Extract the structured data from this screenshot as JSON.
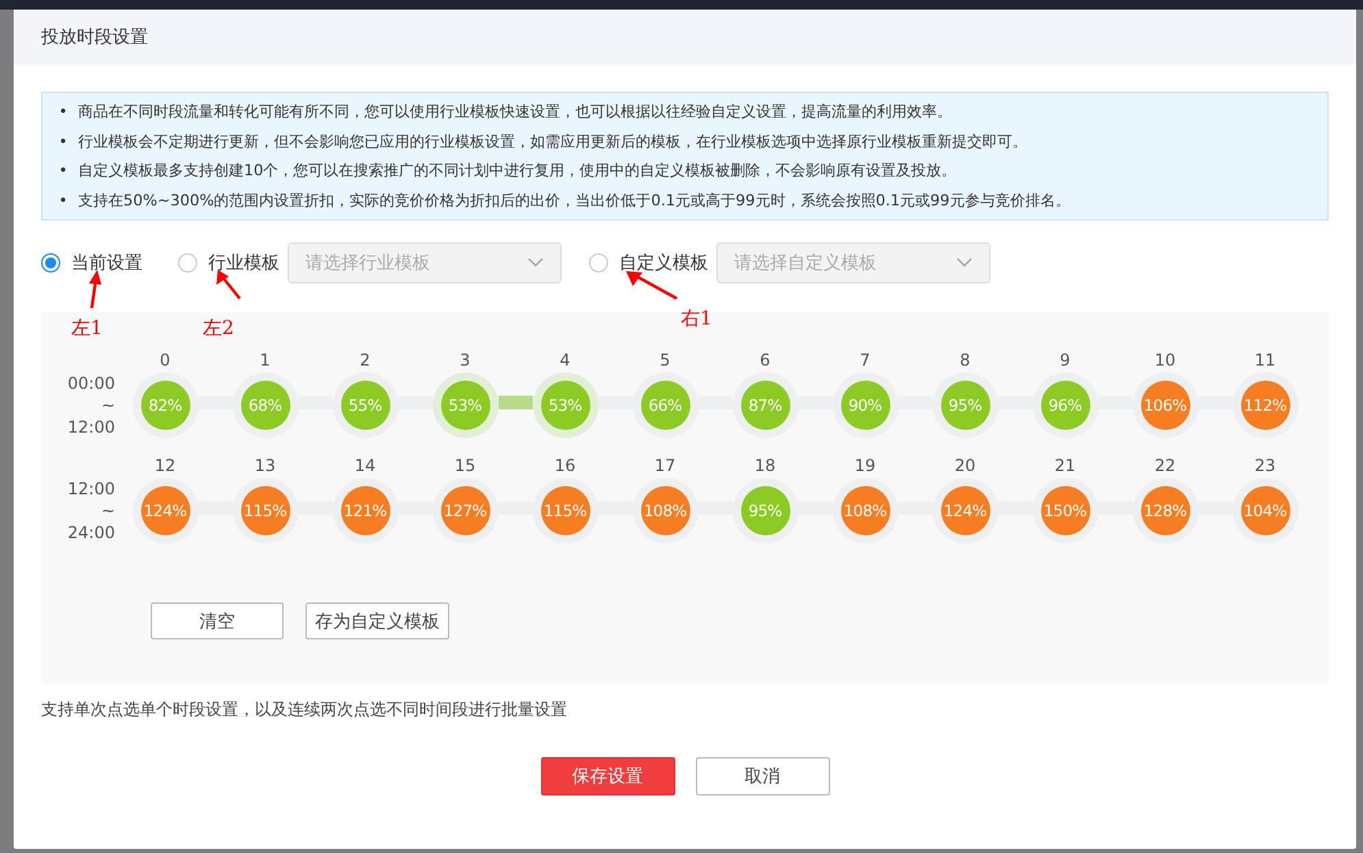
{
  "dialog": {
    "title": "投放时段设置"
  },
  "notes": [
    {
      "marker": "•",
      "text": "商品在不同时段流量和转化可能有所不同，您可以使用行业模板快速设置，也可以根据以往经验自定义设置，提高流量的利用效率。"
    },
    {
      "marker": "•",
      "text": "行业模板会不定期进行更新，但不会影响您已应用的行业模板设置，如需应用更新后的模板，在行业模板选项中选择原行业模板重新提交即可。"
    },
    {
      "marker": "•",
      "text": "自定义模板最多支持创建10个，您可以在搜索推广的不同计划中进行复用，使用中的自定义模板被删除，不会影响原有设置及投放。"
    },
    {
      "marker": "•",
      "text": "支持在50%~300%的范围内设置折扣，实际的竞价价格为折扣后的出价，当出价低于0.1元或高于99元时，系统会按照0.1元或99元参与竞价排名。"
    }
  ],
  "modes": [
    {
      "label": "当前设置",
      "selected": true
    },
    {
      "label": "行业模板",
      "selected": false,
      "placeholder": "请选择行业模板"
    },
    {
      "label": "自定义模板",
      "selected": false,
      "placeholder": "请选择自定义模板"
    }
  ],
  "rows": [
    {
      "start": "00:00",
      "sep": "~",
      "end": "12:00",
      "slots": [
        {
          "hour": "0",
          "value": "82%",
          "color": "#8ccb24",
          "selected": false
        },
        {
          "hour": "1",
          "value": "68%",
          "color": "#8ccb24",
          "selected": false
        },
        {
          "hour": "2",
          "value": "55%",
          "color": "#8ccb24",
          "selected": false
        },
        {
          "hour": "3",
          "value": "53%",
          "color": "#8ccb24",
          "selected": true
        },
        {
          "hour": "4",
          "value": "53%",
          "color": "#8ccb24",
          "selected": true
        },
        {
          "hour": "5",
          "value": "66%",
          "color": "#8ccb24",
          "selected": false
        },
        {
          "hour": "6",
          "value": "87%",
          "color": "#8ccb24",
          "selected": false
        },
        {
          "hour": "7",
          "value": "90%",
          "color": "#8ccb24",
          "selected": false
        },
        {
          "hour": "8",
          "value": "95%",
          "color": "#8ccb24",
          "selected": false
        },
        {
          "hour": "9",
          "value": "96%",
          "color": "#8ccb24",
          "selected": false
        },
        {
          "hour": "10",
          "value": "106%",
          "color": "#f57d22",
          "selected": false
        },
        {
          "hour": "11",
          "value": "112%",
          "color": "#f57d22",
          "selected": false
        }
      ]
    },
    {
      "start": "12:00",
      "sep": "~",
      "end": "24:00",
      "slots": [
        {
          "hour": "12",
          "value": "124%",
          "color": "#f57d22",
          "selected": false
        },
        {
          "hour": "13",
          "value": "115%",
          "color": "#f57d22",
          "selected": false
        },
        {
          "hour": "14",
          "value": "121%",
          "color": "#f57d22",
          "selected": false
        },
        {
          "hour": "15",
          "value": "127%",
          "color": "#f57d22",
          "selected": false
        },
        {
          "hour": "16",
          "value": "115%",
          "color": "#f57d22",
          "selected": false
        },
        {
          "hour": "17",
          "value": "108%",
          "color": "#f57d22",
          "selected": false
        },
        {
          "hour": "18",
          "value": "95%",
          "color": "#8ccb24",
          "selected": false
        },
        {
          "hour": "19",
          "value": "108%",
          "color": "#f57d22",
          "selected": false
        },
        {
          "hour": "20",
          "value": "124%",
          "color": "#f57d22",
          "selected": false
        },
        {
          "hour": "21",
          "value": "150%",
          "color": "#f57d22",
          "selected": false
        },
        {
          "hour": "22",
          "value": "128%",
          "color": "#f57d22",
          "selected": false
        },
        {
          "hour": "23",
          "value": "104%",
          "color": "#f57d22",
          "selected": false
        }
      ]
    }
  ],
  "actions": [
    "清空",
    "存为自定义模板"
  ],
  "hint": "支持单次点选单个时段设置，以及连续两次点选不同时间段进行批量设置",
  "footer": [
    {
      "label": "保存设置",
      "kind": "primary"
    },
    {
      "label": "取消",
      "kind": "default"
    }
  ],
  "annotations": [
    "左1",
    "左2",
    "右1"
  ]
}
